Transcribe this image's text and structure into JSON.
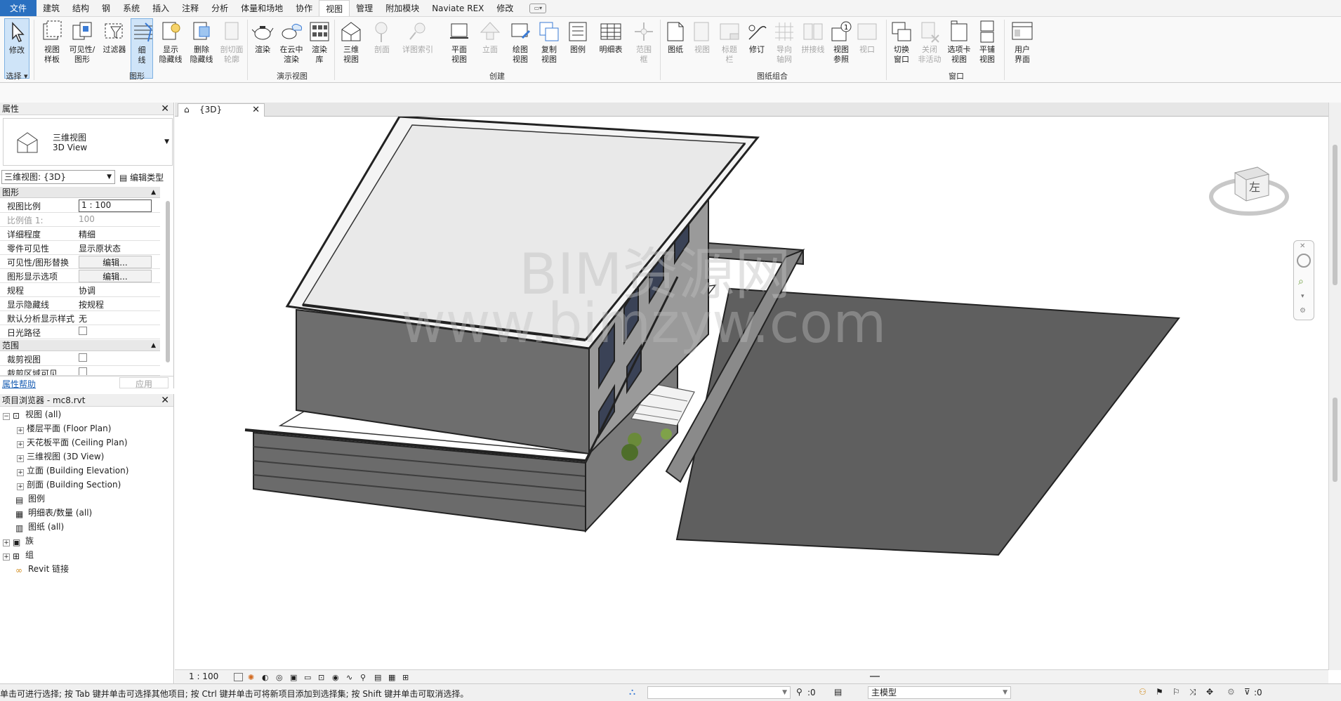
{
  "menu": {
    "tabs": [
      "文件",
      "建筑",
      "结构",
      "钢",
      "系统",
      "插入",
      "注释",
      "分析",
      "体量和场地",
      "协作",
      "视图",
      "管理",
      "附加模块",
      "Naviate REX",
      "修改"
    ],
    "active": "视图"
  },
  "ribbon": {
    "buttons": [
      {
        "label": "修改"
      },
      {
        "label": "视图\n样板"
      },
      {
        "label": "可见性/\n图形"
      },
      {
        "label": "过滤器"
      },
      {
        "label": "细\n线"
      },
      {
        "label": "显示\n隐藏线"
      },
      {
        "label": "删除\n隐藏线"
      },
      {
        "label": "剖切面\n轮廓"
      },
      {
        "label": "渲染"
      },
      {
        "label": "在云中\n渲染"
      },
      {
        "label": "渲染\n库"
      },
      {
        "label": "三维\n视图"
      },
      {
        "label": "剖面"
      },
      {
        "label": "详图索引"
      },
      {
        "label": "平面\n视图"
      },
      {
        "label": "立面"
      },
      {
        "label": "绘图\n视图"
      },
      {
        "label": "复制\n视图"
      },
      {
        "label": "图例"
      },
      {
        "label": "明细表"
      },
      {
        "label": "范围\n框"
      },
      {
        "label": "图纸"
      },
      {
        "label": "视图"
      },
      {
        "label": "标题\n栏"
      },
      {
        "label": "修订"
      },
      {
        "label": "导向\n轴网"
      },
      {
        "label": "拼接线"
      },
      {
        "label": "视图\n参照"
      },
      {
        "label": "视口"
      },
      {
        "label": "切换\n窗口"
      },
      {
        "label": "关闭\n非活动"
      },
      {
        "label": "选项卡\n视图"
      },
      {
        "label": "平铺\n视图"
      },
      {
        "label": "用户\n界面"
      }
    ],
    "panels": [
      "选择",
      "图形",
      "演示视图",
      "创建",
      "图纸组合",
      "窗口"
    ]
  },
  "properties": {
    "title": "属性",
    "type_name_cn": "三维视图",
    "type_name_en": "3D View",
    "instance": "三维视图: {3D}",
    "edit_type": "编辑类型",
    "groups": [
      "图形",
      "范围"
    ],
    "rows": [
      {
        "k": "视图比例",
        "v": "1 : 100"
      },
      {
        "k": "比例值 1:",
        "v": "100"
      },
      {
        "k": "详细程度",
        "v": "精细"
      },
      {
        "k": "零件可见性",
        "v": "显示原状态"
      },
      {
        "k": "可见性/图形替换",
        "v": "编辑..."
      },
      {
        "k": "图形显示选项",
        "v": "编辑..."
      },
      {
        "k": "规程",
        "v": "协调"
      },
      {
        "k": "显示隐藏线",
        "v": "按规程"
      },
      {
        "k": "默认分析显示样式",
        "v": "无"
      },
      {
        "k": "日光路径",
        "v": ""
      },
      {
        "k": "裁剪视图",
        "v": ""
      },
      {
        "k": "裁剪区域可见",
        "v": ""
      }
    ],
    "help": "属性帮助",
    "apply": "应用"
  },
  "browser": {
    "title": "项目浏览器 - mc8.rvt",
    "items": [
      {
        "label": "视图 (all)"
      },
      {
        "label": "楼层平面 (Floor Plan)"
      },
      {
        "label": "天花板平面 (Ceiling Plan)"
      },
      {
        "label": "三维视图 (3D View)"
      },
      {
        "label": "立面 (Building Elevation)"
      },
      {
        "label": "剖面 (Building Section)"
      },
      {
        "label": "图例"
      },
      {
        "label": "明细表/数量 (all)"
      },
      {
        "label": "图纸 (all)"
      },
      {
        "label": "族"
      },
      {
        "label": "组"
      },
      {
        "label": "Revit 链接"
      }
    ]
  },
  "view": {
    "tab": "{3D}",
    "scale": "1 : 100",
    "viewcube_face": "左",
    "watermark_1": "BIM资源网",
    "watermark_2": "www.bimzyw.com"
  },
  "status": {
    "message": "单击可进行选择; 按 Tab 键并单击可选择其他项目; 按 Ctrl 键并单击可将新项目添加到选择集; 按 Shift 键并单击可取消选择。",
    "sel_count": ":0",
    "model": "主模型",
    "filter_count": ":0"
  },
  "colors": {
    "accent": "#2a70c0",
    "wall": "#6e6e6e",
    "ground": "#5a5a5a",
    "roof": "#e9e9e9"
  }
}
